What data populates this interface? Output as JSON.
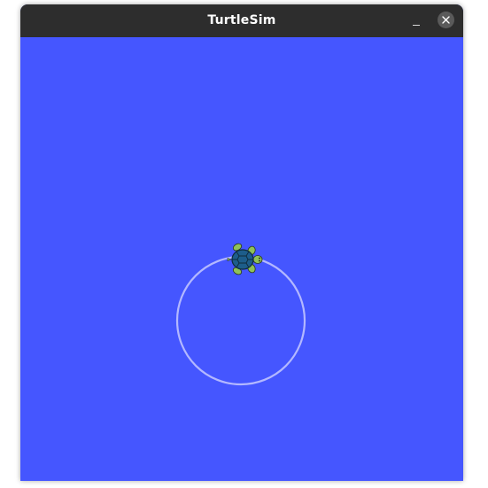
{
  "window": {
    "title": "TurtleSim"
  },
  "canvas": {
    "background_color": "#4556ff",
    "trail_color": "#b3b8ff",
    "turtle_icon": "turtle-icon"
  },
  "colors": {
    "titlebar": "#2d2d2d",
    "close_button": "#5a5a5a"
  }
}
